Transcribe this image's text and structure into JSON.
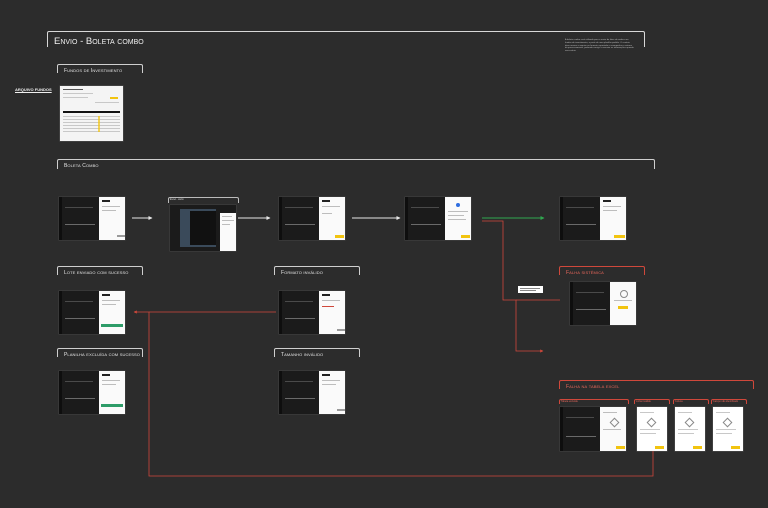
{
  "page": {
    "title": "Envio - Boleta combo",
    "note": "A boleta combo será utilizada para o envio de lotes de ordens em fundos de investimento, a partir de uma planilha padrão. O usuário deve anexar o arquivo no formato suportado e acompanhar o retorno do processamento, podendo corrigir e reenviar as informações quando necessário.",
    "link": "ARQUIVO FUNDOS"
  },
  "sections": {
    "fundos": "Fundos de Investimento",
    "boleta": "Boleta Combo",
    "lote_sucesso": "Lote enviado com sucesso",
    "formato_invalido": "Formato inválido",
    "planilha_excluida": "Planilha excluída com sucesso",
    "tamanho_invalido": "Tamanho inválido",
    "falha_sistemica": "Falha sistêmica",
    "falha_tabela": "Falha na tabela excel"
  },
  "screens": {
    "excel_label": "Excel - vazio",
    "falha_tabs": [
      "Tabela excluída",
      "Linha inválida",
      "Coluna",
      "Campo não identificado"
    ]
  },
  "colors": {
    "background": "#2c2c2c",
    "error": "#d0483b",
    "success_arrow": "#2fa84f",
    "accent": "#f2c40f"
  }
}
